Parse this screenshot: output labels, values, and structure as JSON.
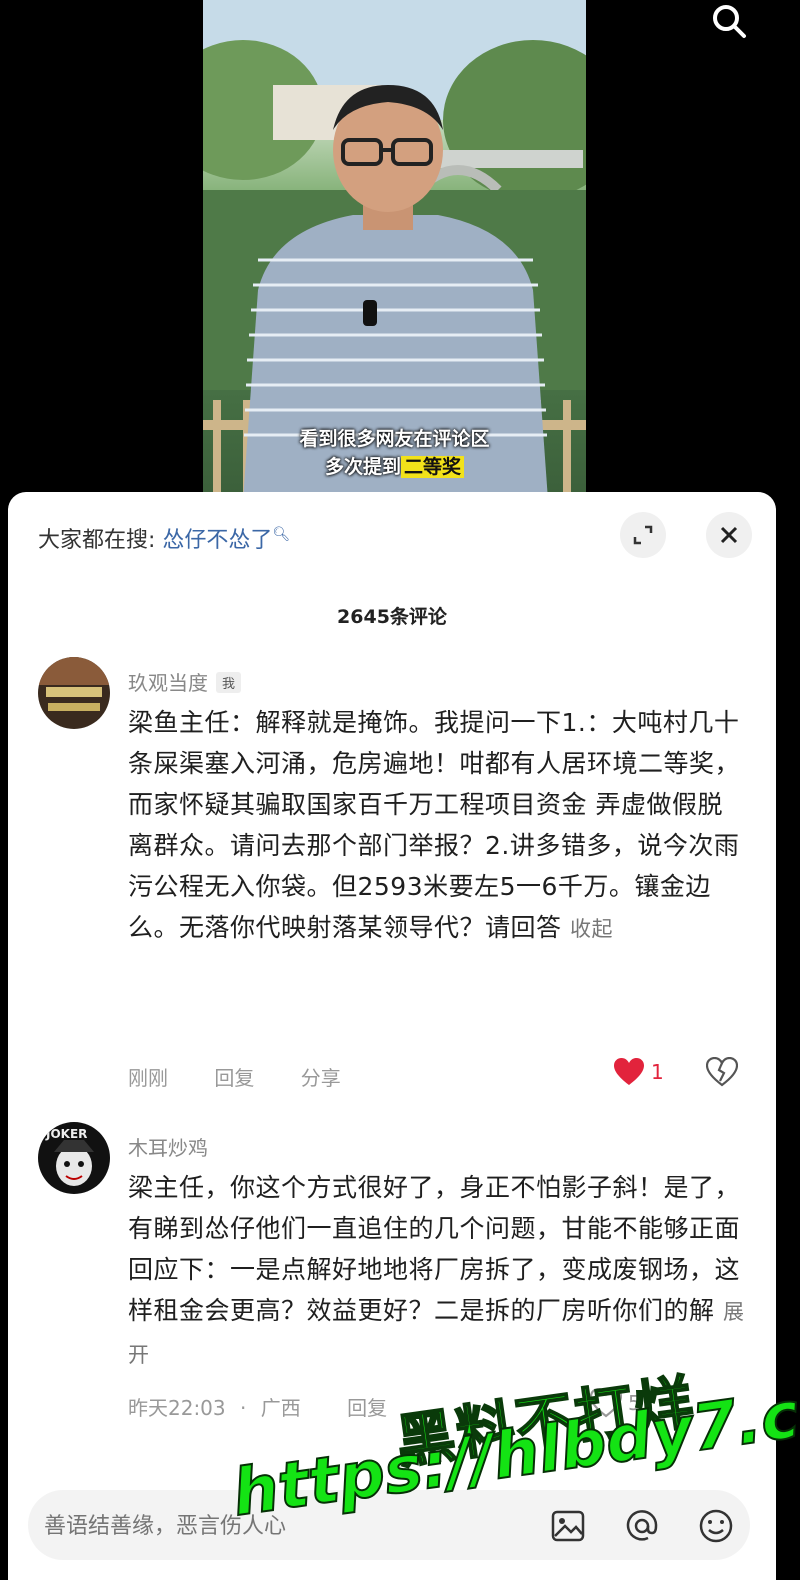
{
  "video": {
    "caption_line1": "看到很多网友在评论区",
    "caption_line2_prefix": "多次提到",
    "caption_line2_highlight": "二等奖"
  },
  "panel": {
    "search_label": "大家都在搜:",
    "search_term": "怂仔不怂了",
    "comment_count": "2645条评论"
  },
  "comments": [
    {
      "username": "玖观当度",
      "badge": "我",
      "text": "梁鱼主任：解释就是掩饰。我提问一下1.：大吨村几十条屎渠塞入河涌，危房遍地！咁都有人居环境二等奖，而家怀疑其骗取国家百千万工程项目资金 弄虚做假脱离群众。请问去那个部门举报？2.讲多错多，说今次雨污公程无入你袋。但2593米要左5一6千万。镶金边么。无落你代映射落某领导代？请回答",
      "collapse": "收起",
      "time": "刚刚",
      "reply": "回复",
      "share": "分享",
      "likes": "1"
    },
    {
      "username": "木耳炒鸡",
      "text": "梁主任，你这个方式很好了，身正不怕影子斜！是了，有睇到怂仔他们一直追住的几个问题，甘能不能够正面回应下：一是点解好地地将厂房拆了，变成废钢场，这样租金会更高？效益更好？二是拆的厂房听你们的解",
      "expand": "展开",
      "time": "昨天22:03",
      "location": "广西",
      "reply": "回复",
      "likes": "5"
    }
  ],
  "input": {
    "placeholder": "善语结善缘，恶言伤人心"
  },
  "watermark": {
    "title": "黑料不打烊",
    "url": "https://hlbdy7.com"
  },
  "icons": {
    "top_search": "search-icon",
    "expand": "expand-icon",
    "close": "close-icon",
    "like": "heart-icon",
    "dislike": "broken-heart-icon",
    "image": "image-icon",
    "mention": "at-icon",
    "emoji": "emoji-icon"
  },
  "colors": {
    "accent_blue": "#3b67a6",
    "like_red": "#e2233c",
    "watermark_green": "#12e012",
    "caption_highlight": "#f2e21a"
  }
}
